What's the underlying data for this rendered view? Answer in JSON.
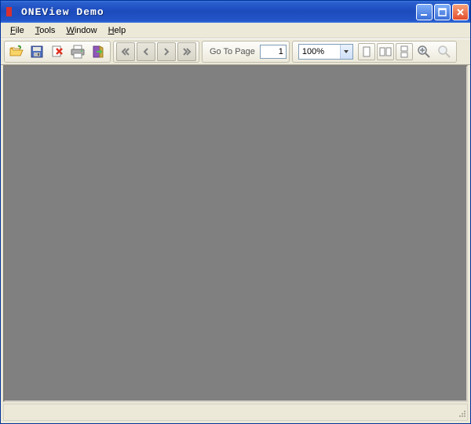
{
  "window": {
    "title": "ONEView Demo"
  },
  "menu": {
    "file": "File",
    "tools": "Tools",
    "window": "Window",
    "help": "Help"
  },
  "toolbar": {
    "goto_label": "Go To Page",
    "goto_value": "1",
    "zoom_value": "100%"
  },
  "icons": {
    "open": "open-folder-icon",
    "save": "floppy-disk-icon",
    "close_doc": "close-document-icon",
    "print": "printer-icon",
    "exit": "exit-door-icon",
    "nav_first": "nav-first-icon",
    "nav_prev": "nav-prev-icon",
    "nav_next": "nav-next-icon",
    "nav_last": "nav-last-icon",
    "page_single": "page-single-icon",
    "page_facing": "page-facing-icon",
    "page_continuous": "page-continuous-icon",
    "zoom_in": "zoom-in-icon",
    "zoom_out": "zoom-out-icon"
  }
}
